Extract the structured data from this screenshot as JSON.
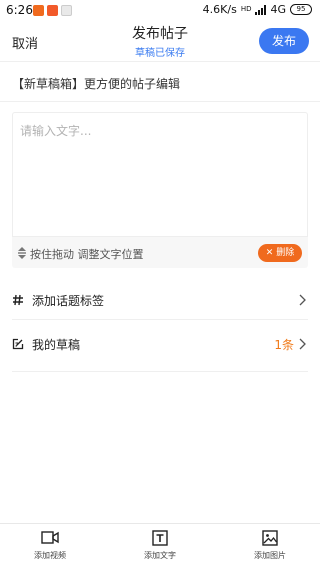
{
  "status_bar": {
    "time": "6:26",
    "speed": "4.6K/s",
    "network": "4G",
    "hd": "HD",
    "battery": "95"
  },
  "header": {
    "cancel_label": "取消",
    "title": "发布帖子",
    "subtitle": "草稿已保存",
    "publish_label": "发布"
  },
  "notice": "【新草稿箱】更方便的帖子编辑",
  "editor": {
    "placeholder": "请输入文字...",
    "drag_hint": "按住拖动 调整文字位置",
    "delete_label": "删除"
  },
  "rows": {
    "topic_label": "添加话题标签",
    "drafts_label": "我的草稿",
    "drafts_count": "1条"
  },
  "toolbar": {
    "video_label": "添加视频",
    "text_label": "添加文字",
    "image_label": "添加图片"
  },
  "colors": {
    "accent_blue": "#3b78f1",
    "delete_orange": "#f06a1e",
    "count_orange": "#f07a1a"
  }
}
